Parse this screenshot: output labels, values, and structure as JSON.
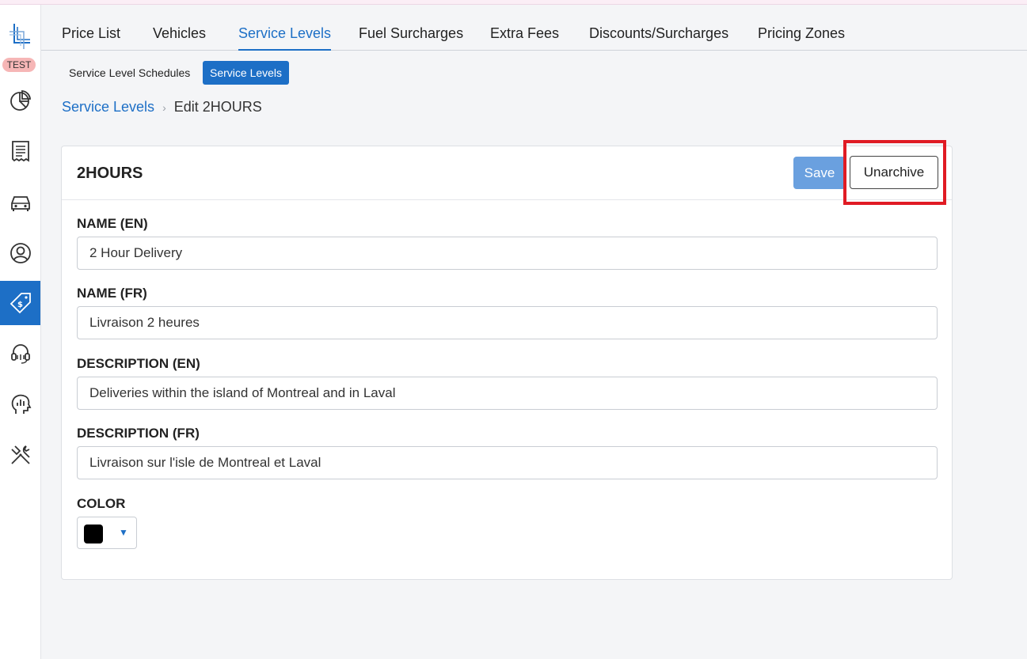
{
  "env_badge": "TEST",
  "colors": {
    "primary": "#1d6fc6",
    "save_disabled": "#6aa0df",
    "highlight": "#e01b24",
    "badge": "#f6b6b6"
  },
  "sidebar": {
    "items": [
      {
        "icon": "pie-chart-icon"
      },
      {
        "icon": "receipt-icon"
      },
      {
        "icon": "car-icon"
      },
      {
        "icon": "user-circle-icon"
      },
      {
        "icon": "price-tag-icon",
        "active": true
      },
      {
        "icon": "headset-icon"
      },
      {
        "icon": "analytics-head-icon"
      },
      {
        "icon": "tools-icon"
      }
    ]
  },
  "tabs": [
    {
      "label": "Price List"
    },
    {
      "label": "Vehicles"
    },
    {
      "label": "Service Levels",
      "active": true
    },
    {
      "label": "Fuel Surcharges"
    },
    {
      "label": "Extra Fees"
    },
    {
      "label": "Discounts/Surcharges"
    },
    {
      "label": "Pricing Zones"
    }
  ],
  "subtabs": [
    {
      "label": "Service Level Schedules"
    },
    {
      "label": "Service Levels",
      "active": true
    }
  ],
  "breadcrumb": {
    "parent": "Service Levels",
    "separator": "›",
    "current": "Edit 2HOURS"
  },
  "card": {
    "title": "2HOURS",
    "save_label": "Save",
    "unarchive_label": "Unarchive",
    "fields": [
      {
        "label": "NAME (EN)",
        "value": "2 Hour Delivery"
      },
      {
        "label": "NAME (FR)",
        "value": "Livraison 2 heures"
      },
      {
        "label": "DESCRIPTION (EN)",
        "value": "Deliveries within the island of Montreal and in Laval"
      },
      {
        "label": "DESCRIPTION (FR)",
        "value": "Livraison sur l'isle de Montreal et Laval"
      }
    ],
    "color_label": "COLOR",
    "color_value": "#000000",
    "color_caret": "▼"
  }
}
